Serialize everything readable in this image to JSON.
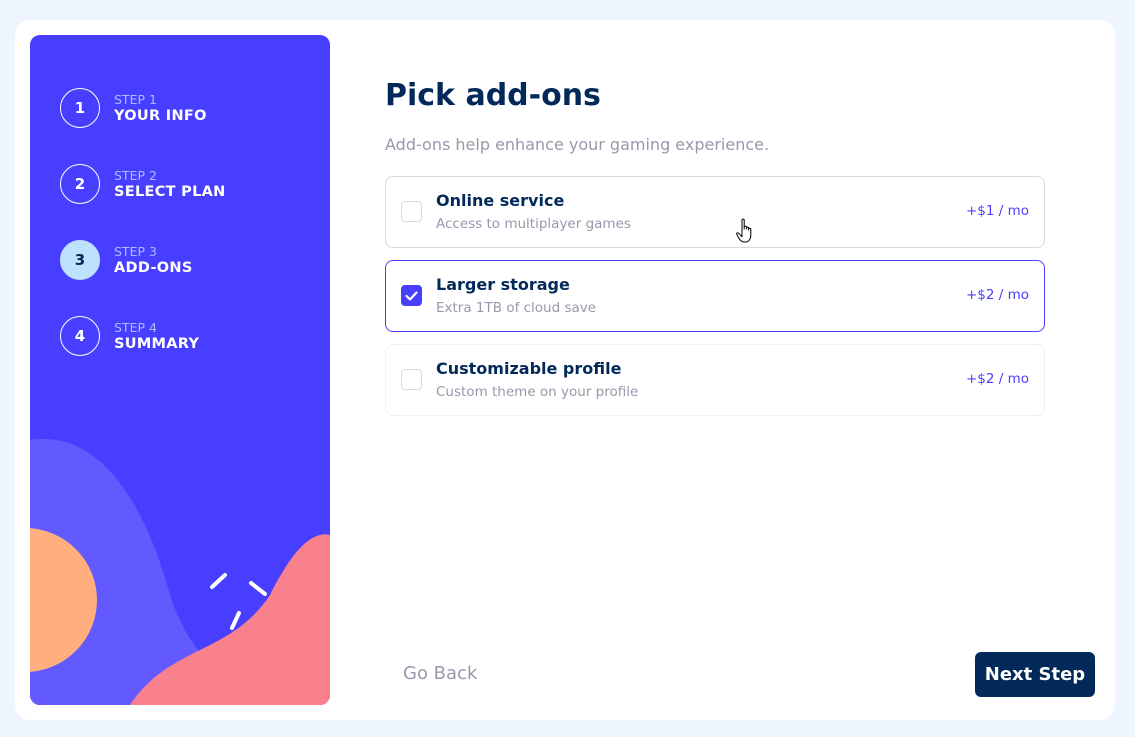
{
  "steps": [
    {
      "num": "1",
      "label": "STEP 1",
      "title": "YOUR INFO",
      "active": false
    },
    {
      "num": "2",
      "label": "STEP 2",
      "title": "SELECT PLAN",
      "active": false
    },
    {
      "num": "3",
      "label": "STEP 3",
      "title": "ADD-ONS",
      "active": true
    },
    {
      "num": "4",
      "label": "STEP 4",
      "title": "SUMMARY",
      "active": false
    }
  ],
  "main": {
    "title": "Pick add-ons",
    "subtitle": "Add-ons help enhance your gaming experience."
  },
  "addons": [
    {
      "name": "Online service",
      "desc": "Access to multiplayer games",
      "price": "+$1 / mo",
      "checked": false
    },
    {
      "name": "Larger storage",
      "desc": "Extra 1TB of cloud save",
      "price": "+$2 / mo",
      "checked": true
    },
    {
      "name": "Customizable profile",
      "desc": "Custom theme on your profile",
      "price": "+$2 / mo",
      "checked": false
    }
  ],
  "footer": {
    "back_label": "Go Back",
    "next_label": "Next Step"
  },
  "colors": {
    "accent": "#483eff",
    "navy": "#022959",
    "active_step": "#bee2fd",
    "grey_text": "#9699aa"
  }
}
